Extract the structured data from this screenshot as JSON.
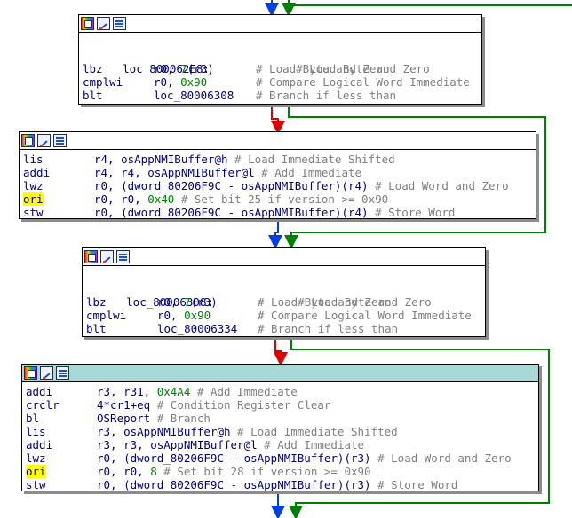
{
  "colors": {
    "code": "#000080",
    "immediate": "#008000",
    "comment": "#808080",
    "true_edge": "#008000",
    "false_edge": "#e00000",
    "unconditional_edge": "#0040e0",
    "selected_header": "#a8d8d8",
    "highlight": "#ffff00"
  },
  "header_icons": [
    "palette-icon",
    "rename-icon",
    "graph-icon"
  ],
  "blocks": [
    {
      "id": "block1",
      "label": "loc_800062E8:",
      "label_comment": "# Load Byte and Zero",
      "lines": [
        {
          "mnem": "lbz",
          "op": "r0, ",
          "num": "7",
          "op2": "(r3)",
          "cmt": "# Load Byte and Zero"
        },
        {
          "mnem": "cmplwi",
          "op": "r0, ",
          "num": "0x90",
          "op2": "",
          "cmt": "# Compare Logical Word Immediate"
        },
        {
          "mnem": "blt",
          "op": "loc_80006308",
          "num": "",
          "op2": "",
          "cmt": "# Branch if less than"
        }
      ]
    },
    {
      "id": "block2",
      "lines": [
        {
          "mnem": "lis",
          "op": "r4, osAppNMIBuffer@h",
          "num": "",
          "op2": "",
          "cmt": "# Load Immediate Shifted"
        },
        {
          "mnem": "addi",
          "op": "r4, r4, osAppNMIBuffer@l",
          "num": "",
          "op2": "",
          "cmt": "# Add Immediate"
        },
        {
          "mnem": "lwz",
          "op": "r0, (dword_80206F9C - osAppNMIBuffer)(r4)",
          "num": "",
          "op2": "",
          "cmt": "# Load Word and Zero"
        },
        {
          "mnem": "ori",
          "highlight": true,
          "op": "r0, r0, ",
          "num": "0x40",
          "op2": "",
          "cmt": "# Set bit 25 if version >= 0x90"
        },
        {
          "mnem": "stw",
          "op": "r0, (dword_80206F9C - osAppNMIBuffer)(r4)",
          "num": "",
          "op2": "",
          "cmt": "# Store Word"
        }
      ]
    },
    {
      "id": "block3",
      "label": "loc_80006308:",
      "label_comment": "# Load Byte and Zero",
      "lines": [
        {
          "mnem": "lbz",
          "op": "r0, ",
          "num": "7",
          "op2": "(r3)",
          "cmt": "# Load Byte and Zero"
        },
        {
          "mnem": "cmplwi",
          "op": "r0, ",
          "num": "0x90",
          "op2": "",
          "cmt": "# Compare Logical Word Immediate"
        },
        {
          "mnem": "blt",
          "op": "loc_80006334",
          "num": "",
          "op2": "",
          "cmt": "# Branch if less than"
        }
      ]
    },
    {
      "id": "block4",
      "lines": [
        {
          "mnem": "addi",
          "op": "r3, r31, ",
          "num": "0x4A4",
          "op2": "",
          "cmt": "# Add Immediate"
        },
        {
          "mnem": "crclr",
          "op": "4*cr1+eq",
          "num": "",
          "op2": "",
          "cmt": "# Condition Register Clear"
        },
        {
          "mnem": "bl",
          "op": "OSReport",
          "num": "",
          "op2": "",
          "cmt": "# Branch"
        },
        {
          "mnem": "lis",
          "op": "r3, osAppNMIBuffer@h",
          "num": "",
          "op2": "",
          "cmt": "# Load Immediate Shifted"
        },
        {
          "mnem": "addi",
          "op": "r3, r3, osAppNMIBuffer@l",
          "num": "",
          "op2": "",
          "cmt": "# Add Immediate"
        },
        {
          "mnem": "lwz",
          "op": "r0, (dword_80206F9C - osAppNMIBuffer)(r3)",
          "num": "",
          "op2": "",
          "cmt": "# Load Word and Zero"
        },
        {
          "mnem": "ori",
          "highlight": true,
          "op": "r0, r0, ",
          "num": "8",
          "op2": "",
          "cmt": "# Set bit 28 if version >= 0x90"
        },
        {
          "mnem": "stw",
          "op": "r0, (dword_80206F9C - osAppNMIBuffer)(r3)",
          "num": "",
          "op2": "",
          "cmt": "# Store Word"
        }
      ]
    }
  ]
}
